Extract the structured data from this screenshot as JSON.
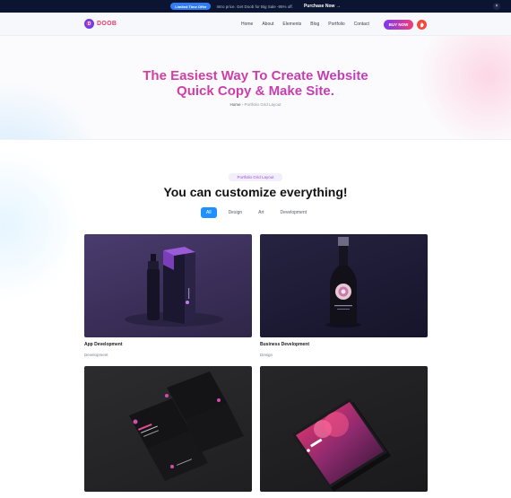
{
  "topbar": {
    "pill": "Limited Time Offer",
    "promo": "Intro price. Get Doob for Big Sale -95% off.",
    "purchase": "Purchase Now",
    "close": "×"
  },
  "header": {
    "logo_mark": "D",
    "logo_text": "DOOB",
    "menu": [
      "Home",
      "About",
      "Elements",
      "Blog",
      "Portfolio",
      "Contact"
    ],
    "buy_label": "BUY NOW"
  },
  "hero": {
    "title_line1": "The Easiest Way To Create Website",
    "title_line2": "Quick Copy & Make Site.",
    "breadcrumb_home": "Home",
    "breadcrumb_separator": "›",
    "breadcrumb_current": "Portfolio Grid Layout"
  },
  "portfolio": {
    "badge": "Portfolio Grid Layout",
    "title": "You can customize everything!",
    "filters": [
      "All",
      "Design",
      "Art",
      "Development"
    ],
    "active_filter": "All",
    "items": [
      {
        "title": "App Development",
        "category": "Development"
      },
      {
        "title": "Business Development",
        "category": "Design"
      }
    ]
  },
  "colors": {
    "accent_gradient_start": "#7b39f1",
    "accent_gradient_end": "#f13c7a",
    "filter_active": "#1e90ff",
    "topbar_bg": "#0b1430"
  }
}
